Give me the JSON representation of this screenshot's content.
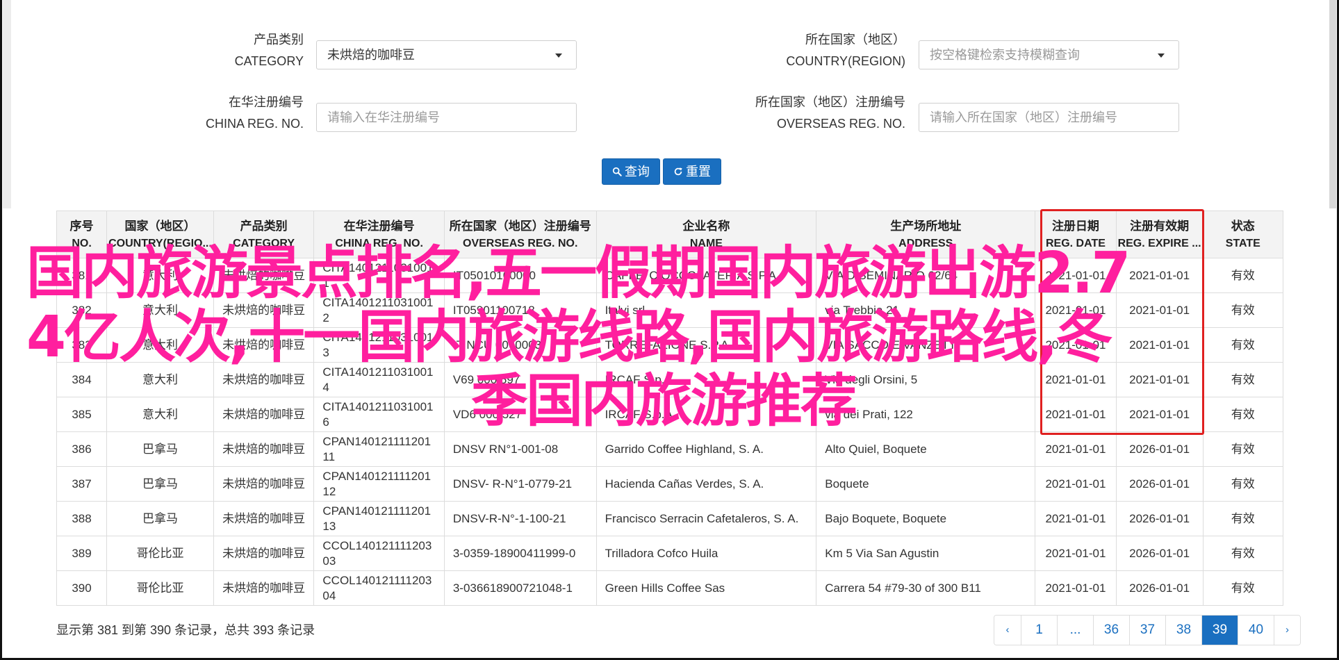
{
  "form": {
    "category": {
      "label_zh": "产品类别",
      "label_en": "CATEGORY",
      "value": "未烘焙的咖啡豆"
    },
    "country": {
      "label_zh": "所在国家（地区）",
      "label_en": "COUNTRY(REGION)",
      "placeholder": "按空格键检索支持模糊查询"
    },
    "china_reg": {
      "label_zh": "在华注册编号",
      "label_en": "CHINA REG. NO.",
      "placeholder": "请输入在华注册编号"
    },
    "overseas_reg": {
      "label_zh": "所在国家（地区）注册编号",
      "label_en": "OVERSEAS REG. NO.",
      "placeholder": "请输入所在国家（地区）注册编号"
    },
    "search_label": "查询",
    "reset_label": "重置"
  },
  "table": {
    "headers": [
      {
        "zh": "序号",
        "en": "NO."
      },
      {
        "zh": "国家（地区）",
        "en": "COUNTRY(REGIO..."
      },
      {
        "zh": "产品类别",
        "en": "CATEGORY"
      },
      {
        "zh": "在华注册编号",
        "en": "CHINA REG. NO."
      },
      {
        "zh": "所在国家（地区）注册编号",
        "en": "OVERSEAS REG. NO."
      },
      {
        "zh": "企业名称",
        "en": "NAME"
      },
      {
        "zh": "生产场所地址",
        "en": "ADDRESS"
      },
      {
        "zh": "注册日期",
        "en": "REG. DATE"
      },
      {
        "zh": "注册有效期",
        "en": "REG. EXPIRE ..."
      },
      {
        "zh": "状态",
        "en": "STATE"
      }
    ],
    "rows": [
      {
        "no": "381",
        "country": "意大利",
        "category": "未烘焙的咖啡豆",
        "china_reg": "CITA14012110310011",
        "overseas_reg": "IT05010160000",
        "name": "CAFFE' CIOCCOLATERIA S.P.A.",
        "address": "VIA DISEMINARIO 62/64",
        "reg_date": "2021-01-01",
        "expire": "2021-01-01",
        "state": "有效"
      },
      {
        "no": "382",
        "country": "意大利",
        "category": "未烘焙的咖啡豆",
        "china_reg": "CITA14012110310012",
        "overseas_reg": "IT05901100718",
        "name": "Italvi srl",
        "address": "via Trebbia 21",
        "reg_date": "2021-01-01",
        "expire": "2021-01-01",
        "state": "有效"
      },
      {
        "no": "383",
        "country": "意大利",
        "category": "未烘焙的咖啡豆",
        "china_reg": "CITA14012110310013",
        "overseas_reg": "IT NCU 0060003",
        "name": "TORREFAZIONE S.P.A.",
        "address": "VIA SACCO E VANZETTI",
        "reg_date": "2021-01-01",
        "expire": "2021-01-01",
        "state": "有效"
      },
      {
        "no": "384",
        "country": "意大利",
        "category": "未烘焙的咖啡豆",
        "china_reg": "CITA14012110310014",
        "overseas_reg": "V69 000 597",
        "name": "IRCAF S.p.A.",
        "address": "Via degli Orsini, 5",
        "reg_date": "2021-01-01",
        "expire": "2021-01-01",
        "state": "有效"
      },
      {
        "no": "385",
        "country": "意大利",
        "category": "未烘焙的咖啡豆",
        "china_reg": "CITA14012110310016",
        "overseas_reg": "VD6 000 527",
        "name": "IRCAF S.p.A.",
        "address": "via dei Prati, 122",
        "reg_date": "2021-01-01",
        "expire": "2021-01-01",
        "state": "有效"
      },
      {
        "no": "386",
        "country": "巴拿马",
        "category": "未烘焙的咖啡豆",
        "china_reg": "CPAN14012111120111",
        "overseas_reg": "DNSV RN°1-001-08",
        "name": "Garrido Coffee Highland, S. A.",
        "address": "Alto Quiel, Boquete",
        "reg_date": "2021-01-01",
        "expire": "2026-01-01",
        "state": "有效"
      },
      {
        "no": "387",
        "country": "巴拿马",
        "category": "未烘焙的咖啡豆",
        "china_reg": "CPAN14012111120112",
        "overseas_reg": "DNSV- R-N°1-0779-21",
        "name": "Hacienda Cañas Verdes, S. A.",
        "address": "Boquete",
        "reg_date": "2021-01-01",
        "expire": "2026-01-01",
        "state": "有效"
      },
      {
        "no": "388",
        "country": "巴拿马",
        "category": "未烘焙的咖啡豆",
        "china_reg": "CPAN14012111120113",
        "overseas_reg": "DNSV-R-N°-1-100-21",
        "name": "Francisco Serracin Cafetaleros, S. A.",
        "address": "Bajo Boquete, Boquete",
        "reg_date": "2021-01-01",
        "expire": "2026-01-01",
        "state": "有效"
      },
      {
        "no": "389",
        "country": "哥伦比亚",
        "category": "未烘焙的咖啡豆",
        "china_reg": "CCOL14012111120303",
        "overseas_reg": "3-0359-18900411999-0",
        "name": "Trilladora Cofco Huila",
        "address": "Km 5 Via San Agustin",
        "reg_date": "2021-01-01",
        "expire": "2026-01-01",
        "state": "有效"
      },
      {
        "no": "390",
        "country": "哥伦比亚",
        "category": "未烘焙的咖啡豆",
        "china_reg": "CCOL14012111120304",
        "overseas_reg": "3-036618900721048-1",
        "name": "Green Hills Coffee Sas",
        "address": "Carrera 54 #79-30 of 300 B11",
        "reg_date": "2021-01-01",
        "expire": "2026-01-01",
        "state": "有效"
      }
    ]
  },
  "overlay": {
    "line1": "国内旅游景点排名,五一假期国内旅游出游2.7",
    "line2": "4亿人次,十一国内旅游线路,国内旅游路线,冬",
    "line3": "季国内旅游推荐"
  },
  "footer": {
    "summary": "显示第 381 到第 390 条记录，总共 393 条记录",
    "pages": [
      "‹",
      "1",
      "...",
      "36",
      "37",
      "38",
      "39",
      "40",
      "›"
    ],
    "active_page": "39"
  },
  "colors": {
    "accent": "#1a6fc0",
    "highlight": "#e02020",
    "overlay_text": "#ff1f9e"
  }
}
